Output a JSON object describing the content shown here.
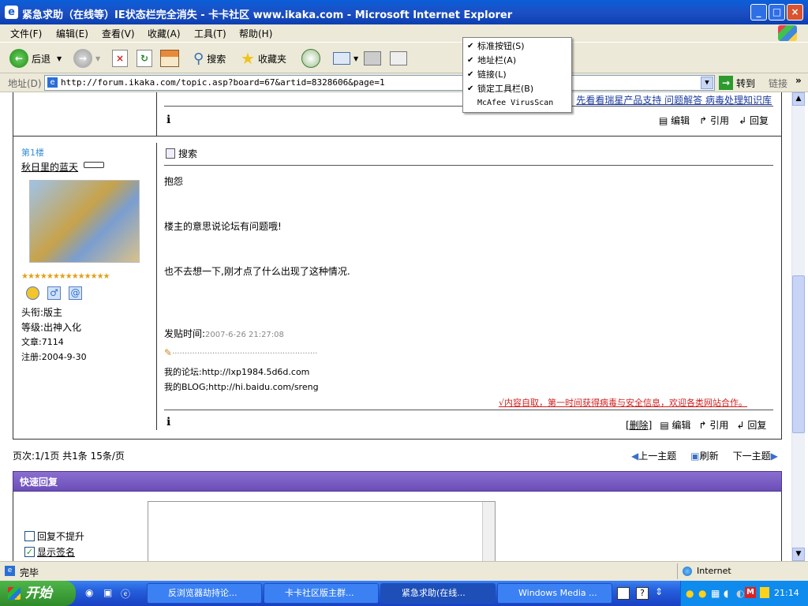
{
  "window": {
    "title": "紧急求助（在线等）IE状态栏完全消失 - 卡卡社区 www.ikaka.com - Microsoft Internet Explorer",
    "min_glyph": "_",
    "max_glyph": "□",
    "close_glyph": "×"
  },
  "menubar": {
    "items": [
      "文件(F)",
      "编辑(E)",
      "查看(V)",
      "收藏(A)",
      "工具(T)",
      "帮助(H)"
    ]
  },
  "toolbar": {
    "back_label": "后退",
    "search_label": "搜索",
    "favorites_label": "收藏夹"
  },
  "address_bar": {
    "label": "地址(D)",
    "url": "http://forum.ikaka.com/topic.asp?board=67&artid=8328606&page=1",
    "go_label": "转到",
    "links_label": "链接"
  },
  "view_menu": {
    "items": [
      {
        "label": "标准按钮(S)",
        "checked": true
      },
      {
        "label": "地址栏(A)",
        "checked": true
      },
      {
        "label": "链接(L)",
        "checked": true
      },
      {
        "label": "锁定工具栏(B)",
        "checked": true
      },
      {
        "label": "McAfee VirusScan",
        "checked": false
      }
    ]
  },
  "top_post": {
    "links": "先看看瑞星产品支持  问题解答  病毒处理知识库",
    "edit": "编辑",
    "quote": "引用",
    "reply": "回复"
  },
  "post": {
    "floor": "第1楼",
    "author": "秋日里的蓝天",
    "title_label": "头衔:",
    "title_value": "版主",
    "level_label": "等级:",
    "level_value": "出神入化",
    "articles_label": "文章:",
    "articles_value": "7114",
    "registered_label": "注册:",
    "registered_value": "2004-9-30",
    "stars": "★★★★★★★★★★★★★★",
    "search_label": "搜索",
    "line1": "抱怨",
    "line2": "楼主的意思说论坛有问题哦!",
    "line3": "也不去想一下,刚才点了什么出现了这种情况.",
    "time_label": "发贴时间:",
    "time_value": "2007-6-26 21:27:08",
    "sig_dots": "..........................................................",
    "sig1": "我的论坛:http://lxp1984.5d6d.com",
    "sig2": "我的BLOG;http://hi.baidu.com/sreng",
    "promo": "√内容自取，第一时间获得病毒与安全信息，欢迎各类网站合作。",
    "delete": "[删除]",
    "edit": "编辑",
    "quote": "引用",
    "reply": "回复"
  },
  "pager": {
    "info": "页次:1/1页 共1条 15条/页",
    "prev": "上一主题",
    "refresh": "刷新",
    "next": "下一主题"
  },
  "quick_reply": {
    "title": "快速回复",
    "no_bump": "回复不提升",
    "show_sig": "显示签名"
  },
  "status": {
    "text": "完毕",
    "zone": "Internet"
  },
  "taskbar": {
    "start": "开始",
    "tasks": [
      "反浏览器劫持论...",
      "卡卡社区版主群...",
      "紧急求助(在线...",
      "Windows Media ..."
    ],
    "clock": "21:14"
  }
}
